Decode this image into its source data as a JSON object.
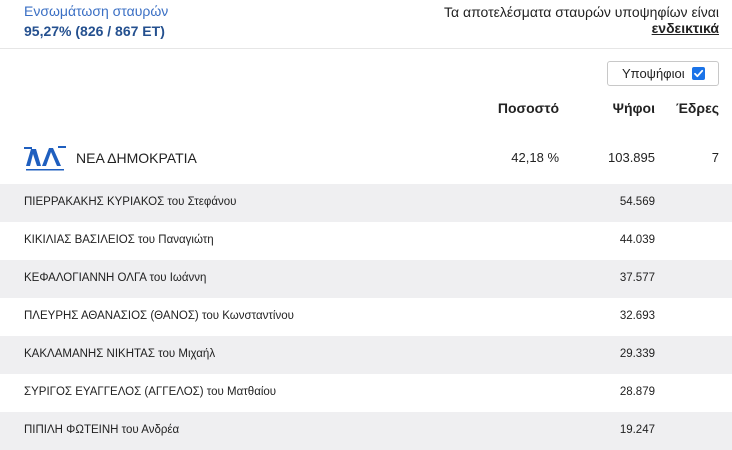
{
  "header": {
    "integration_label": "Ενσωμάτωση σταυρών",
    "integration_value": "95,27% (826 / 867 ΕΤ)",
    "notice_line": "Τα αποτελέσματα σταυρών υποψηφίων είναι",
    "notice_emphasis": "ενδεικτικά"
  },
  "candidates_toggle": {
    "label": "Υποψήφιοι",
    "checked": true,
    "color": "#1a73e8"
  },
  "columns": {
    "percent": "Ποσοστό",
    "votes": "Ψήφοι",
    "seats": "Έδρες"
  },
  "party": {
    "logo_icon": "nd-party-logo",
    "logo_text": "ΝΔ ΝΕΑ ΔΗΜΟΚΡΑΤΙΑ",
    "name": "ΝΕΑ ΔΗΜΟΚΡΑΤΙΑ",
    "percent": "42,18 %",
    "votes": "103.895",
    "seats": "7",
    "color": "#1f5fbf"
  },
  "candidates": [
    {
      "name": "ΠΙΕΡΡΑΚΑΚΗΣ ΚΥΡΙΑΚΟΣ του Στεφάνου",
      "votes": "54.569"
    },
    {
      "name": "ΚΙΚΙΛΙΑΣ ΒΑΣΙΛΕΙΟΣ του Παναγιώτη",
      "votes": "44.039"
    },
    {
      "name": "ΚΕΦΑΛΟΓΙΑΝΝΗ ΟΛΓΑ του Ιωάννη",
      "votes": "37.577"
    },
    {
      "name": "ΠΛΕΥΡΗΣ ΑΘΑΝΑΣΙΟΣ (ΘΑΝΟΣ) του Κωνσταντίνου",
      "votes": "32.693"
    },
    {
      "name": "ΚΑΚΛΑΜΑΝΗΣ ΝΙΚΗΤΑΣ του Μιχαήλ",
      "votes": "29.339"
    },
    {
      "name": "ΣΥΡΙΓΟΣ ΕΥΑΓΓΕΛΟΣ (ΑΓΓΕΛΟΣ) του Ματθαίου",
      "votes": "28.879"
    },
    {
      "name": "ΠΙΠΙΛΗ ΦΩΤΕΙΝΗ του Ανδρέα",
      "votes": "19.247"
    }
  ]
}
